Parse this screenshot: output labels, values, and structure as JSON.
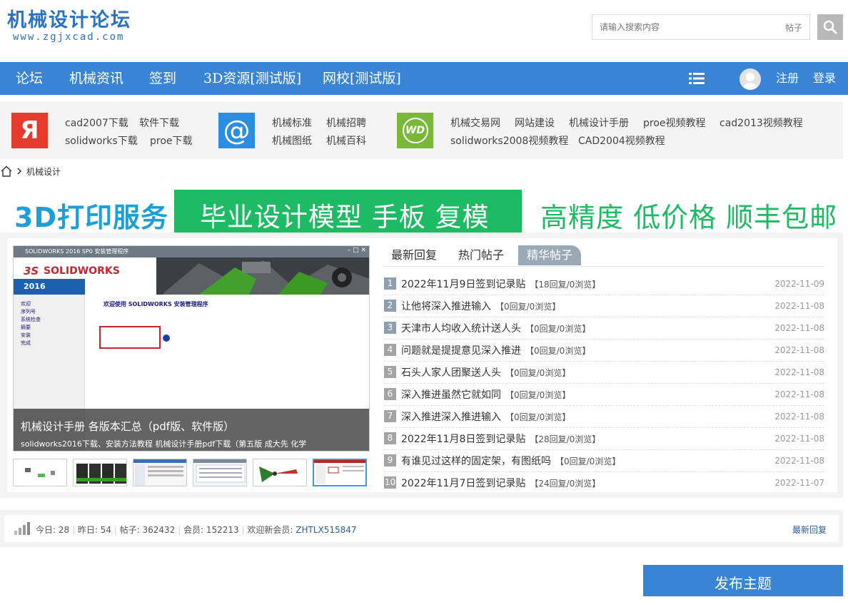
{
  "site": {
    "logo_title": "机械设计论坛",
    "logo_url": "www.zgjxcad.com"
  },
  "search": {
    "placeholder": "请输入搜索内容",
    "type_label": "帖子"
  },
  "nav": {
    "items": [
      "论坛",
      "机械资讯",
      "签到",
      "3D资源[测试版]",
      "网校[测试版]"
    ],
    "register": "注册",
    "login": "登录"
  },
  "quick_links": {
    "group1": [
      "cad2007下载",
      "软件下载",
      "solidworks下载",
      "proe下载"
    ],
    "group2": [
      "机械标准",
      "机械招聘",
      "机械图纸",
      "机械百科"
    ],
    "group3_row1": [
      "机械交易网",
      "网站建设",
      "机械设计手册",
      "proe视频教程",
      "cad2013视频教程"
    ],
    "group3_row2": [
      "solidworks2008视频教程",
      "CAD2004视频教程"
    ],
    "icon1_glyph": "Я",
    "icon2_glyph": "@",
    "icon3_glyph": "WD"
  },
  "breadcrumb": {
    "current": "机械设计"
  },
  "banner": {
    "left": "3D打印服务",
    "middle": "毕业设计模型  手板 复模",
    "right": "高精度  低价格 顺丰包邮"
  },
  "slide": {
    "window_title": "SOLIDWORKS 2016 SP0 安装管理程序",
    "brand": "SOLIDWORKS",
    "year": "2016",
    "welcome": "欢迎使用 SOLIDWORKS 安装管理程序",
    "caption_title": "机械设计手册 各版本汇总（pdf版、软件版）",
    "caption_sub": "solidworks2016下载、安装方法教程 机械设计手册pdf下载（第五版 成大先 化学"
  },
  "tabs": [
    "最新回复",
    "热门帖子",
    "精华帖子"
  ],
  "posts": [
    {
      "num": "1",
      "title": "2022年11月9日签到记录贴",
      "meta": "【18回复/0浏览】",
      "date": "2022-11-09"
    },
    {
      "num": "2",
      "title": "让他将深入推进输入",
      "meta": "【0回复/0浏览】",
      "date": "2022-11-08"
    },
    {
      "num": "3",
      "title": "天津市人均收入统计送人头",
      "meta": "【0回复/0浏览】",
      "date": "2022-11-08"
    },
    {
      "num": "4",
      "title": "问题就是提提意见深入推进",
      "meta": "【0回复/0浏览】",
      "date": "2022-11-08"
    },
    {
      "num": "5",
      "title": "石头人家人团聚送人头",
      "meta": "【0回复/0浏览】",
      "date": "2022-11-08"
    },
    {
      "num": "6",
      "title": "深入推进虽然它就如同",
      "meta": "【0回复/0浏览】",
      "date": "2022-11-08"
    },
    {
      "num": "7",
      "title": "深入推进深入推进输入",
      "meta": "【0回复/0浏览】",
      "date": "2022-11-08"
    },
    {
      "num": "8",
      "title": "2022年11月8日签到记录贴",
      "meta": "【28回复/0浏览】",
      "date": "2022-11-08"
    },
    {
      "num": "9",
      "title": "有谁见过这样的固定架，有图纸吗",
      "meta": "【0回复/0浏览】",
      "date": "2022-11-08"
    },
    {
      "num": "10",
      "title": "2022年11月7日签到记录贴",
      "meta": "【24回复/0浏览】",
      "date": "2022-11-07"
    }
  ],
  "stats": {
    "today": "今日: 28",
    "yesterday": "昨日: 54",
    "posts": "帖子: 362432",
    "members": "会员: 152213",
    "welcome": "欢迎新会员: ",
    "new_member": "ZHTLX515847",
    "latest_link": "最新回复"
  },
  "post_button": "发布主题",
  "colors": {
    "nav_bg": "#3a84d6",
    "brand_blue": "#2a73c4",
    "banner_green": "#1dbb63",
    "banner_blue": "#1e9fd8"
  }
}
